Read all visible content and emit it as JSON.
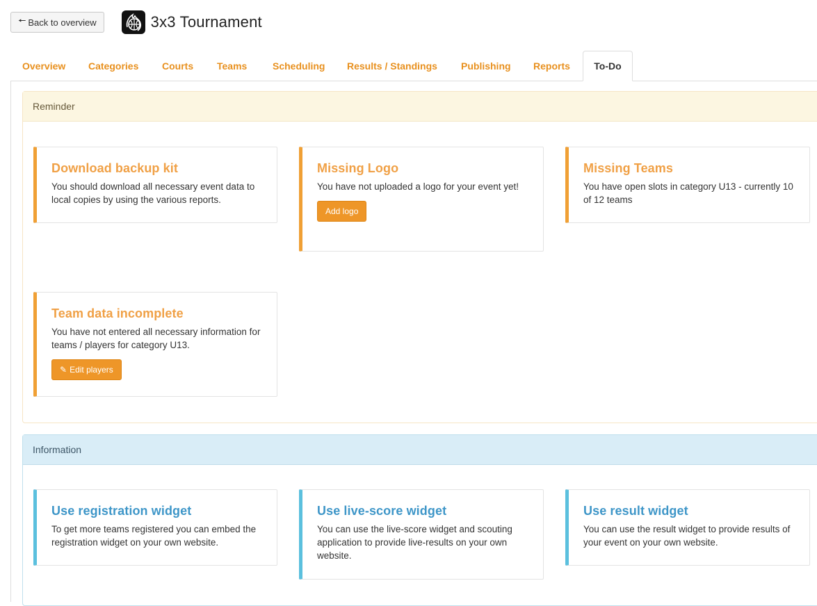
{
  "header": {
    "back_label": "Back to overview",
    "back_icon": "arrow-left-icon",
    "title": "3x3 Tournament"
  },
  "tabs": [
    {
      "label": "Overview",
      "active": false
    },
    {
      "label": "Categories",
      "active": false
    },
    {
      "label": "Courts",
      "active": false
    },
    {
      "label": "Teams",
      "active": false
    },
    {
      "label": "Scheduling",
      "active": false
    },
    {
      "label": "Results / Standings",
      "active": false
    },
    {
      "label": "Publishing",
      "active": false
    },
    {
      "label": "Reports",
      "active": false
    },
    {
      "label": "To-Do",
      "active": true
    }
  ],
  "colors": {
    "accent_orange": "#f0a035",
    "accent_blue": "#5bc0de",
    "tab_text": "#e8901e"
  },
  "reminder": {
    "heading": "Reminder",
    "cards": [
      {
        "title": "Download backup kit",
        "text": "You should download all necessary event data to local copies by using the various reports."
      },
      {
        "title": "Missing Logo",
        "text": "You have not uploaded a logo for your event yet!",
        "button": "Add logo"
      },
      {
        "title": "Missing Teams",
        "text": "You have open slots in category U13 - currently 10 of 12 teams"
      },
      {
        "title": "Team data incomplete",
        "text": "You have not entered all necessary information for teams / players for category U13.",
        "button": "Edit players",
        "button_icon": "edit-icon"
      }
    ]
  },
  "information": {
    "heading": "Information",
    "cards": [
      {
        "title": "Use registration widget",
        "text": "To get more teams registered you can embed the registration widget on your own website."
      },
      {
        "title": "Use live-score widget",
        "text": "You can use the live-score widget and scouting application to provide live-results on your own website."
      },
      {
        "title": "Use result widget",
        "text": "You can use the result widget to provide results of your event on your own website."
      }
    ]
  }
}
